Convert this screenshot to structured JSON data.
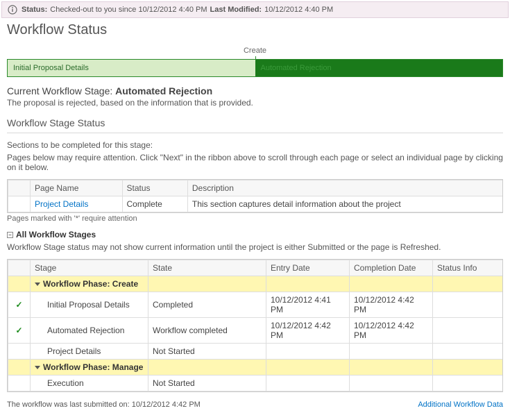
{
  "statusbar": {
    "status_label": "Status:",
    "status_text": "Checked-out to you since 10/12/2012 4:40 PM",
    "lastmod_label": "Last Modified:",
    "lastmod_text": "10/12/2012 4:40 PM"
  },
  "page_title": "Workflow Status",
  "phase": {
    "create_label": "Create",
    "seg1": "Initial Proposal Details",
    "seg2": "Automated Rejection"
  },
  "current_stage": {
    "label": "Current Workflow Stage:",
    "value": "Automated Rejection",
    "description": "The proposal is rejected, based on the information that is provided."
  },
  "stage_status_heading": "Workflow Stage Status",
  "sections": {
    "heading": "Sections to be completed for this stage:",
    "hint": "Pages below may require attention. Click \"Next\" in the ribbon above to scroll through each page or select an individual page by clicking on it below.",
    "cols": {
      "page": "Page Name",
      "status": "Status",
      "desc": "Description"
    },
    "rows": [
      {
        "page": "Project Details",
        "status": "Complete",
        "desc": "This section captures detail information about the project"
      }
    ],
    "footnote": "Pages marked with '*' require attention"
  },
  "all_stages": {
    "toggle_label": "All Workflow Stages",
    "hint": "Workflow Stage status may not show current information until the project is either Submitted or the page is Refreshed.",
    "cols": {
      "stage": "Stage",
      "state": "State",
      "entry": "Entry Date",
      "completion": "Completion Date",
      "info": "Status Info"
    },
    "rows": [
      {
        "type": "phase",
        "label": "Workflow Phase: Create"
      },
      {
        "type": "stage",
        "check": true,
        "stage": "Initial Proposal Details",
        "state": "Completed",
        "entry": "10/12/2012 4:41 PM",
        "completion": "10/12/2012 4:42 PM",
        "info": ""
      },
      {
        "type": "stage",
        "check": true,
        "stage": "Automated Rejection",
        "state": "Workflow completed",
        "entry": "10/12/2012 4:42 PM",
        "completion": "10/12/2012 4:42 PM",
        "info": ""
      },
      {
        "type": "stage",
        "check": false,
        "stage": "Project Details",
        "state": "Not Started",
        "entry": "",
        "completion": "",
        "info": ""
      },
      {
        "type": "phase",
        "label": "Workflow Phase: Manage"
      },
      {
        "type": "stage",
        "check": false,
        "stage": "Execution",
        "state": "Not Started",
        "entry": "",
        "completion": "",
        "info": ""
      }
    ]
  },
  "footer": {
    "submitted": "The workflow was last submitted on: 10/12/2012 4:42 PM",
    "link": "Additional Workflow Data"
  }
}
